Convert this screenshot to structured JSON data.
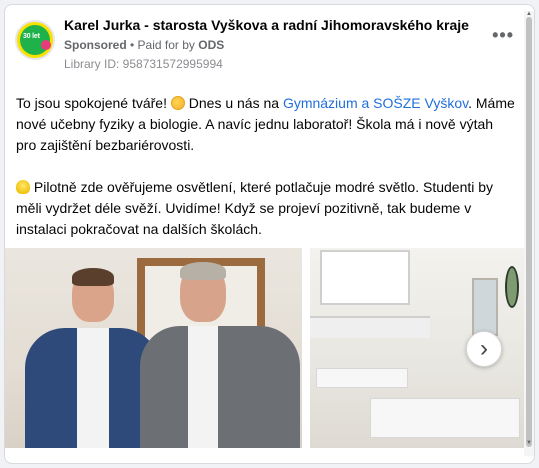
{
  "post": {
    "author": "Karel Jurka - starosta Vyškova a radní Jihomoravského kraje",
    "sponsored": "Sponsored",
    "paid_prefix": " • Paid for by ",
    "paid_by": "ODS",
    "library_id": "Library ID: 958731572995994",
    "more": "•••",
    "avatar_text": "30 let"
  },
  "body": {
    "p1_a": "To jsou spokojené tváře! ",
    "p1_b": " Dnes u nás na ",
    "p1_link": "Gymnázium a SOŠZE Vyškov",
    "p1_c": ". Máme nové učebny fyziky a biologie. A navíc jednu laboratoř! Škola má i nově výtah pro zajištění bezbariérovosti.",
    "p2_a": " Pilotně zde ověřujeme osvětlení, které potlačuje modré světlo. Studenti by měli vydržet déle svěží. Uvidíme! Když se projeví pozitivně, tak budeme v instalaci pokračovat na dalších školách."
  },
  "gallery": {
    "next": "›"
  },
  "icons": {
    "face": "smiling-face-icon",
    "bulb": "lightbulb-icon"
  }
}
